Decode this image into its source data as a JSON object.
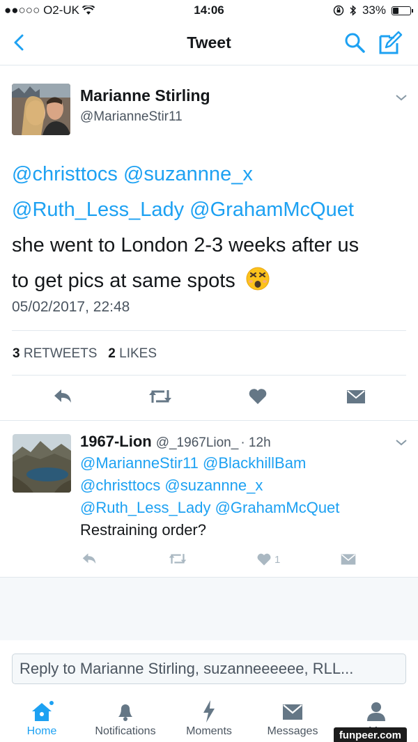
{
  "status_bar": {
    "carrier": "●●○○○ O2-UK",
    "time": "14:06",
    "battery": "33%",
    "battery_level": 0.33
  },
  "nav": {
    "title": "Tweet",
    "back_icon": "chevron-left-icon",
    "search_icon": "search-icon",
    "compose_icon": "compose-icon"
  },
  "tweet": {
    "author_name": "Marianne Stirling",
    "author_handle": "@MarianneStir11",
    "mentions_line1": [
      "@christtocs",
      "@suzannne_x"
    ],
    "mentions_line2": [
      "@Ruth_Less_Lady",
      "@GrahamMcQuet"
    ],
    "text_line1": "she went to London 2-3 weeks after us",
    "text_line2": "to get pics at same spots",
    "emoji": "astonished-face-emoji",
    "timestamp": "05/02/2017, 22:48",
    "retweet_count": "3",
    "retweet_label": "RETWEETS",
    "like_count": "2",
    "like_label": "LIKES"
  },
  "reply": {
    "name": "1967-Lion",
    "handle": "@_1967Lion_",
    "time": "· 12h",
    "mentions_line1": [
      "@MarianneStir11",
      "@BlackhillBam"
    ],
    "mentions_line2": [
      "@christtocs",
      "@suzannne_x"
    ],
    "mentions_line3": [
      "@Ruth_Less_Lady",
      "@GrahamMcQuet"
    ],
    "text": "Restraining order?",
    "like_count": "1"
  },
  "reply_input": {
    "placeholder": "Reply to Marianne Stirling, suzanneeeeee, RLL..."
  },
  "tabs": [
    {
      "label": "Home",
      "icon": "home-icon",
      "active": true
    },
    {
      "label": "Notifications",
      "icon": "bell-icon"
    },
    {
      "label": "Moments",
      "icon": "lightning-icon"
    },
    {
      "label": "Messages",
      "icon": "envelope-icon"
    },
    {
      "label": "Me",
      "icon": "person-icon"
    }
  ],
  "watermark": "funpeer.com",
  "colors": {
    "accent": "#1da1f2",
    "text": "#14171a",
    "secondary": "#4b5560",
    "divider": "#e1e8ed"
  }
}
